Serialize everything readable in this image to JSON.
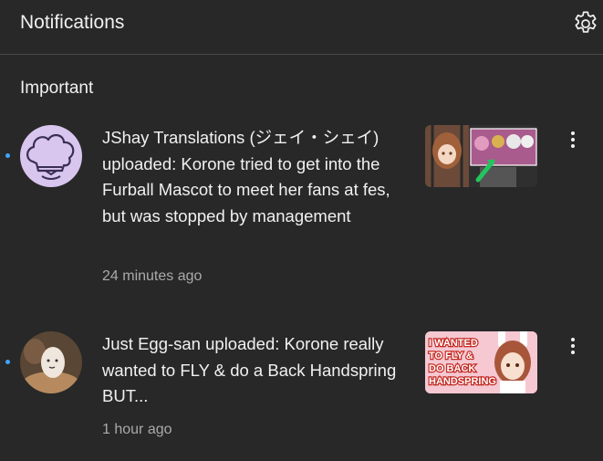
{
  "header": {
    "title": "Notifications",
    "settings_icon": "gear-icon"
  },
  "section": {
    "title": "Important"
  },
  "notifications": [
    {
      "text": "JShay Translations (ジェイ・シェイ) uploaded: Korone tried to get into the Furball Mascot to meet her fans at fes, but was stopped by management",
      "time": "24 minutes ago",
      "unread": true
    },
    {
      "text": "Just Egg-san uploaded: Korone really wanted to FLY & do a Back Handspring BUT...",
      "time": "1 hour ago",
      "unread": true
    }
  ],
  "thumbnail_text": {
    "line1": "I WANTED",
    "line2": "TO FLY &",
    "line3": "DO BACK",
    "line4": "HANDSPRING"
  },
  "colors": {
    "background": "#282828",
    "unread_dot": "#3ea6ff",
    "secondary_text": "#aaaaaa"
  }
}
